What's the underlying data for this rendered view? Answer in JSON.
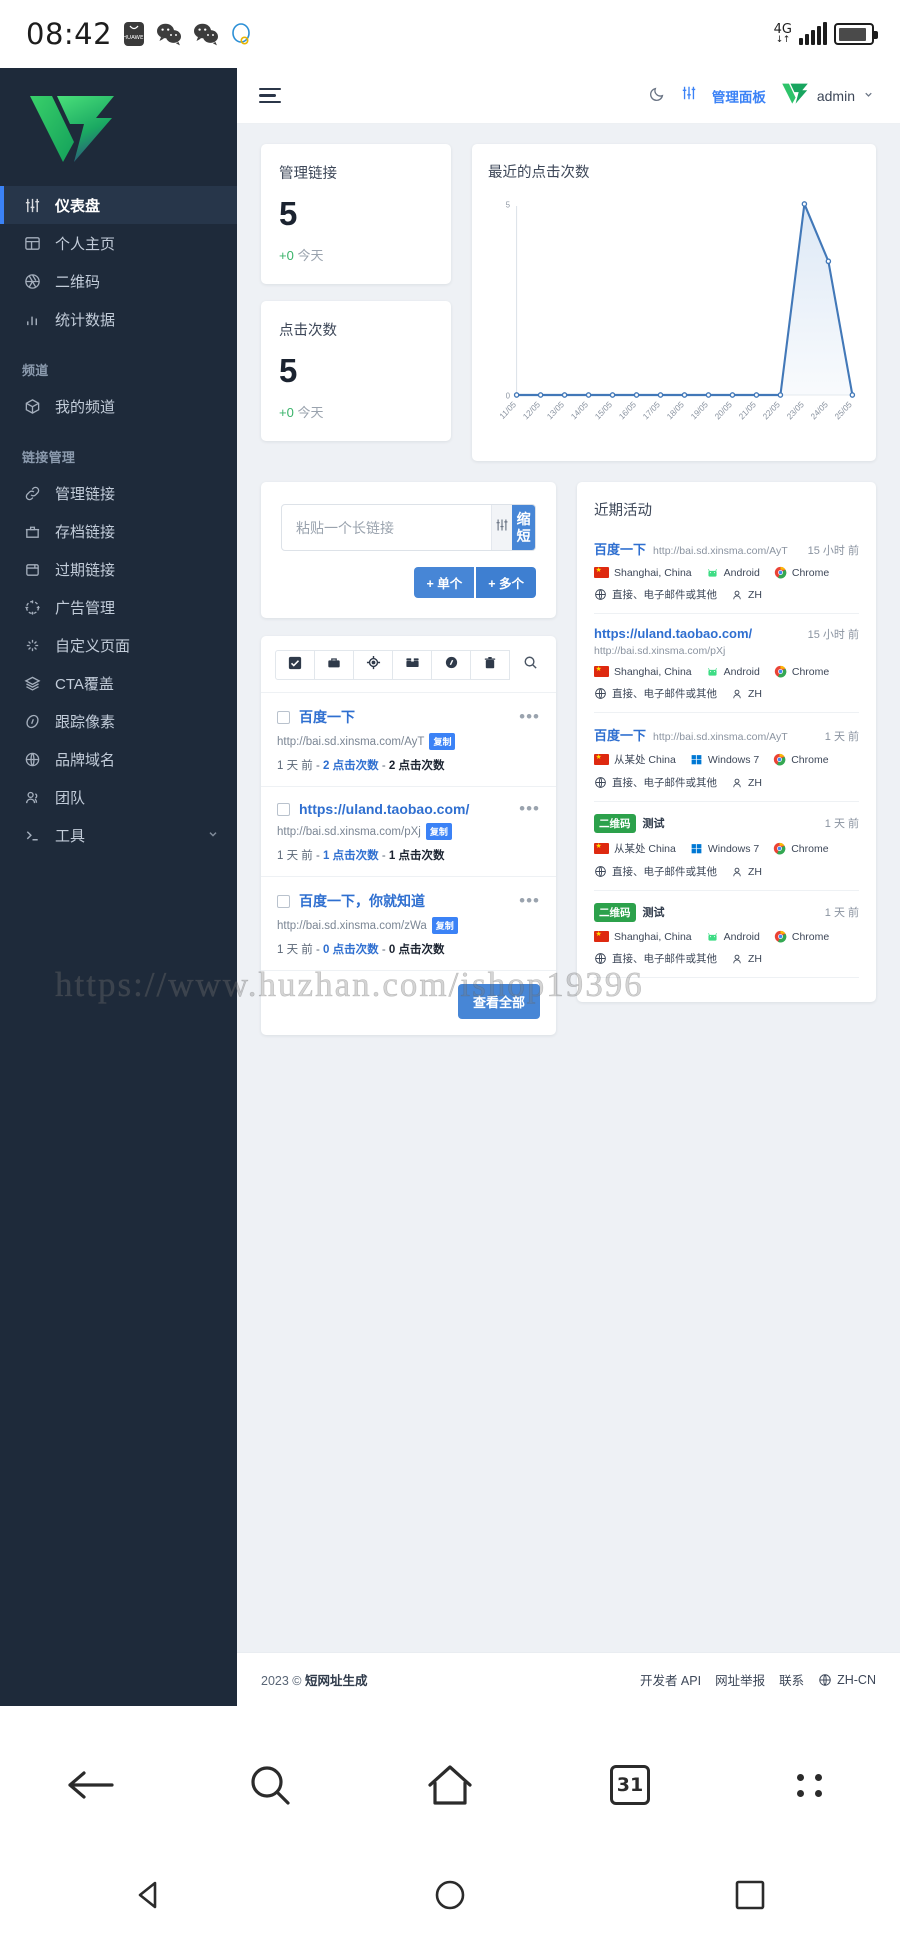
{
  "status_bar": {
    "time": "08:42",
    "icons": [
      "huawei-icon",
      "wechat-icon",
      "wechat-icon",
      "qq-icon"
    ],
    "network": "4G",
    "network_sub": "↓↑"
  },
  "sidebar": {
    "logo": "v-logo",
    "groups": [
      {
        "label": "",
        "items": [
          {
            "label": "仪表盘",
            "icon": "sliders-icon",
            "active": true
          },
          {
            "label": "个人主页",
            "icon": "layout-icon",
            "active": false
          },
          {
            "label": "二维码",
            "icon": "aperture-icon",
            "active": false
          },
          {
            "label": "统计数据",
            "icon": "bar-chart-icon",
            "active": false
          }
        ]
      },
      {
        "label": "频道",
        "items": [
          {
            "label": "我的频道",
            "icon": "package-icon",
            "active": false
          }
        ]
      },
      {
        "label": "链接管理",
        "items": [
          {
            "label": "管理链接",
            "icon": "link-icon",
            "active": false
          },
          {
            "label": "存档链接",
            "icon": "archive-icon",
            "active": false
          },
          {
            "label": "过期链接",
            "icon": "calendar-icon",
            "active": false
          },
          {
            "label": "广告管理",
            "icon": "target-icon",
            "active": false
          },
          {
            "label": "自定义页面",
            "icon": "sparkle-icon",
            "active": false
          },
          {
            "label": "CTA覆盖",
            "icon": "layers-icon",
            "active": false
          },
          {
            "label": "跟踪像素",
            "icon": "compass-icon",
            "active": false
          },
          {
            "label": "品牌域名",
            "icon": "globe-icon",
            "active": false
          },
          {
            "label": "团队",
            "icon": "users-icon",
            "active": false
          },
          {
            "label": "工具",
            "icon": "terminal-icon",
            "active": false,
            "chevron": true
          }
        ]
      }
    ]
  },
  "topbar": {
    "menu_icon": "hamburger-icon",
    "theme_icon": "moon-icon",
    "panel_icon": "sliders-icon",
    "panel_label": "管理面板",
    "avatar": "v-logo-avatar",
    "user": "admin",
    "chevron": "chevron-down-icon"
  },
  "stats": [
    {
      "title": "管理链接",
      "value": "5",
      "delta": "+0",
      "delta_label": "今天"
    },
    {
      "title": "点击次数",
      "value": "5",
      "delta": "+0",
      "delta_label": "今天"
    }
  ],
  "chart_data": {
    "type": "area",
    "title": "最近的点击次数",
    "categories": [
      "11/05",
      "12/05",
      "13/05",
      "14/05",
      "15/05",
      "16/05",
      "17/05",
      "18/05",
      "19/05",
      "20/05",
      "21/05",
      "22/05",
      "23/05",
      "24/05",
      "25/05"
    ],
    "values": [
      0,
      0,
      0,
      0,
      0,
      0,
      0,
      0,
      0,
      0,
      0,
      0,
      5,
      3.5,
      0
    ],
    "ylim": [
      0,
      5
    ],
    "yticks": [
      "0",
      "5"
    ],
    "xlabel": "",
    "ylabel": "",
    "grid": false,
    "legend": "none",
    "line_color": "#4278b8",
    "fill_color": "#dbe7f5"
  },
  "shortener": {
    "placeholder": "粘贴一个长链接",
    "options_icon": "sliders-icon",
    "submit_label": "缩短",
    "add_single": "+ 单个",
    "add_multi": "+ 多个"
  },
  "links_toolbar": [
    {
      "icon": "checkbox-checked-icon",
      "name": "select-all"
    },
    {
      "icon": "briefcase-icon",
      "name": "archive"
    },
    {
      "icon": "target-icon",
      "name": "pixel"
    },
    {
      "icon": "box-icon",
      "name": "bulk"
    },
    {
      "icon": "compass-icon",
      "name": "tracking"
    },
    {
      "icon": "trash-icon",
      "name": "delete"
    },
    {
      "icon": "search-icon",
      "name": "search"
    }
  ],
  "links": [
    {
      "title": "百度一下",
      "url": "http://bai.sd.xinsma.com/AyT",
      "copy": "复制",
      "time": "1 天 前",
      "clicks": "2 点击次数",
      "unique": "2 点击次数"
    },
    {
      "title": "https://uland.taobao.com/",
      "url": "http://bai.sd.xinsma.com/pXj",
      "copy": "复制",
      "time": "1 天 前",
      "clicks": "1 点击次数",
      "unique": "1 点击次数"
    },
    {
      "title": "百度一下，你就知道",
      "url": "http://bai.sd.xinsma.com/zWa",
      "copy": "复制",
      "time": "1 天 前",
      "clicks": "0 点击次数",
      "unique": "0 点击次数"
    }
  ],
  "links_footer": {
    "view_all": "查看全部"
  },
  "activity": {
    "title": "近期活动",
    "items": [
      {
        "name": "百度一下",
        "tag": "",
        "url": "http://bai.sd.xinsma.com/AyT",
        "time": "15 小时 前",
        "location": "Shanghai, China",
        "os": "Android",
        "os_icon": "android-icon",
        "browser": "Chrome",
        "source": "直接、电子邮件或其他",
        "lang": "ZH"
      },
      {
        "name": "https://uland.taobao.com/",
        "tag": "",
        "url": "http://bai.sd.xinsma.com/pXj",
        "time": "15 小时 前",
        "location": "Shanghai, China",
        "os": "Android",
        "os_icon": "android-icon",
        "browser": "Chrome",
        "source": "直接、电子邮件或其他",
        "lang": "ZH"
      },
      {
        "name": "百度一下",
        "tag": "",
        "url": "http://bai.sd.xinsma.com/AyT",
        "time": "1 天 前",
        "location": "从某处 China",
        "os": "Windows 7",
        "os_icon": "windows-icon",
        "browser": "Chrome",
        "source": "直接、电子邮件或其他",
        "lang": "ZH"
      },
      {
        "name": "测试",
        "tag": "二维码",
        "url": "",
        "time": "1 天 前",
        "location": "从某处 China",
        "os": "Windows 7",
        "os_icon": "windows-icon",
        "browser": "Chrome",
        "source": "直接、电子邮件或其他",
        "lang": "ZH"
      },
      {
        "name": "测试",
        "tag": "二维码",
        "url": "",
        "time": "1 天 前",
        "location": "Shanghai, China",
        "os": "Android",
        "os_icon": "android-icon",
        "browser": "Chrome",
        "source": "直接、电子邮件或其他",
        "lang": "ZH"
      }
    ]
  },
  "footer": {
    "copyright": "2023 © ",
    "brand": "短网址生成",
    "links": [
      "开发者 API",
      "网址举报",
      "联系"
    ],
    "lang": "ZH-CN",
    "globe_icon": "globe-icon"
  },
  "watermark": "https://www.huzhan.com/ishop19396",
  "browser_nav": {
    "back": "back-arrow-icon",
    "search": "search-icon",
    "home": "home-icon",
    "tabs_count": "31",
    "menu": "more-dots-icon"
  },
  "system_nav": {
    "back": "triangle-back-icon",
    "home": "circle-home-icon",
    "recents": "square-recents-icon"
  }
}
